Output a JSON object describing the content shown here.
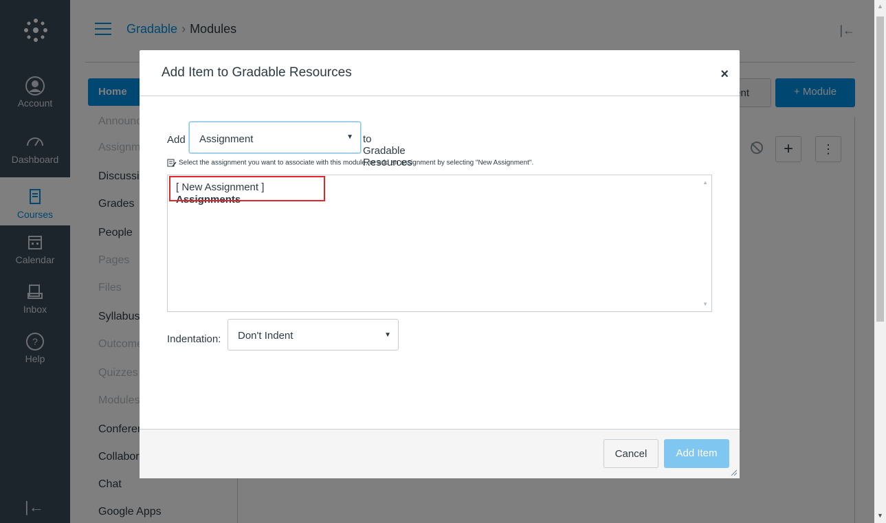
{
  "global_nav": {
    "items": [
      {
        "label": "Account",
        "icon": "account-icon"
      },
      {
        "label": "Dashboard",
        "icon": "dashboard-icon"
      },
      {
        "label": "Courses",
        "icon": "courses-icon"
      },
      {
        "label": "Calendar",
        "icon": "calendar-icon"
      },
      {
        "label": "Inbox",
        "icon": "inbox-icon"
      },
      {
        "label": "Help",
        "icon": "help-icon"
      }
    ],
    "active": "Courses",
    "collapse_glyph": "|←"
  },
  "header": {
    "breadcrumb_course": "Gradable",
    "breadcrumb_sep": "›",
    "breadcrumb_current": "Modules",
    "collapse_glyph": "|←"
  },
  "course_nav": {
    "home": "Home",
    "items": [
      {
        "label": "Announcements",
        "dim": true
      },
      {
        "label": "Assignments",
        "dim": true
      },
      {
        "label": "Discussions",
        "dim": false
      },
      {
        "label": "Grades",
        "dim": false
      },
      {
        "label": "People",
        "dim": false
      },
      {
        "label": "Pages",
        "dim": true
      },
      {
        "label": "Files",
        "dim": true
      },
      {
        "label": "Syllabus",
        "dim": false
      },
      {
        "label": "Outcomes",
        "dim": true
      },
      {
        "label": "Quizzes",
        "dim": true
      },
      {
        "label": "Modules",
        "dim": true
      },
      {
        "label": "Conferences",
        "dim": false
      },
      {
        "label": "Collaborations",
        "dim": false
      },
      {
        "label": "Chat",
        "dim": false
      },
      {
        "label": "Google Apps",
        "dim": false
      }
    ]
  },
  "toolbar": {
    "content_button": "tent",
    "module_button": "+ Module",
    "plus_glyph": "+",
    "kebab_glyph": "⋮"
  },
  "modal": {
    "title": "Add Item to Gradable Resources",
    "close_glyph": "×",
    "add_label": "Add",
    "item_type_value": "Assignment",
    "to_label": "to Gradable Resources",
    "hint": "Select the assignment you want to associate with this module, or add an assignment by selecting \"New Assignment\".",
    "options": {
      "new_item": "[ New Assignment ]",
      "group_label": "Assignments"
    },
    "indentation_label": "Indentation:",
    "indentation_value": "Don't Indent",
    "cancel": "Cancel",
    "add_item": "Add Item",
    "dropdown_glyph": "▼"
  },
  "colors": {
    "brand": "#008ee2",
    "nav_bg": "#394b58",
    "highlight": "#e2262b",
    "disabled_button": "#7fc6f0"
  }
}
